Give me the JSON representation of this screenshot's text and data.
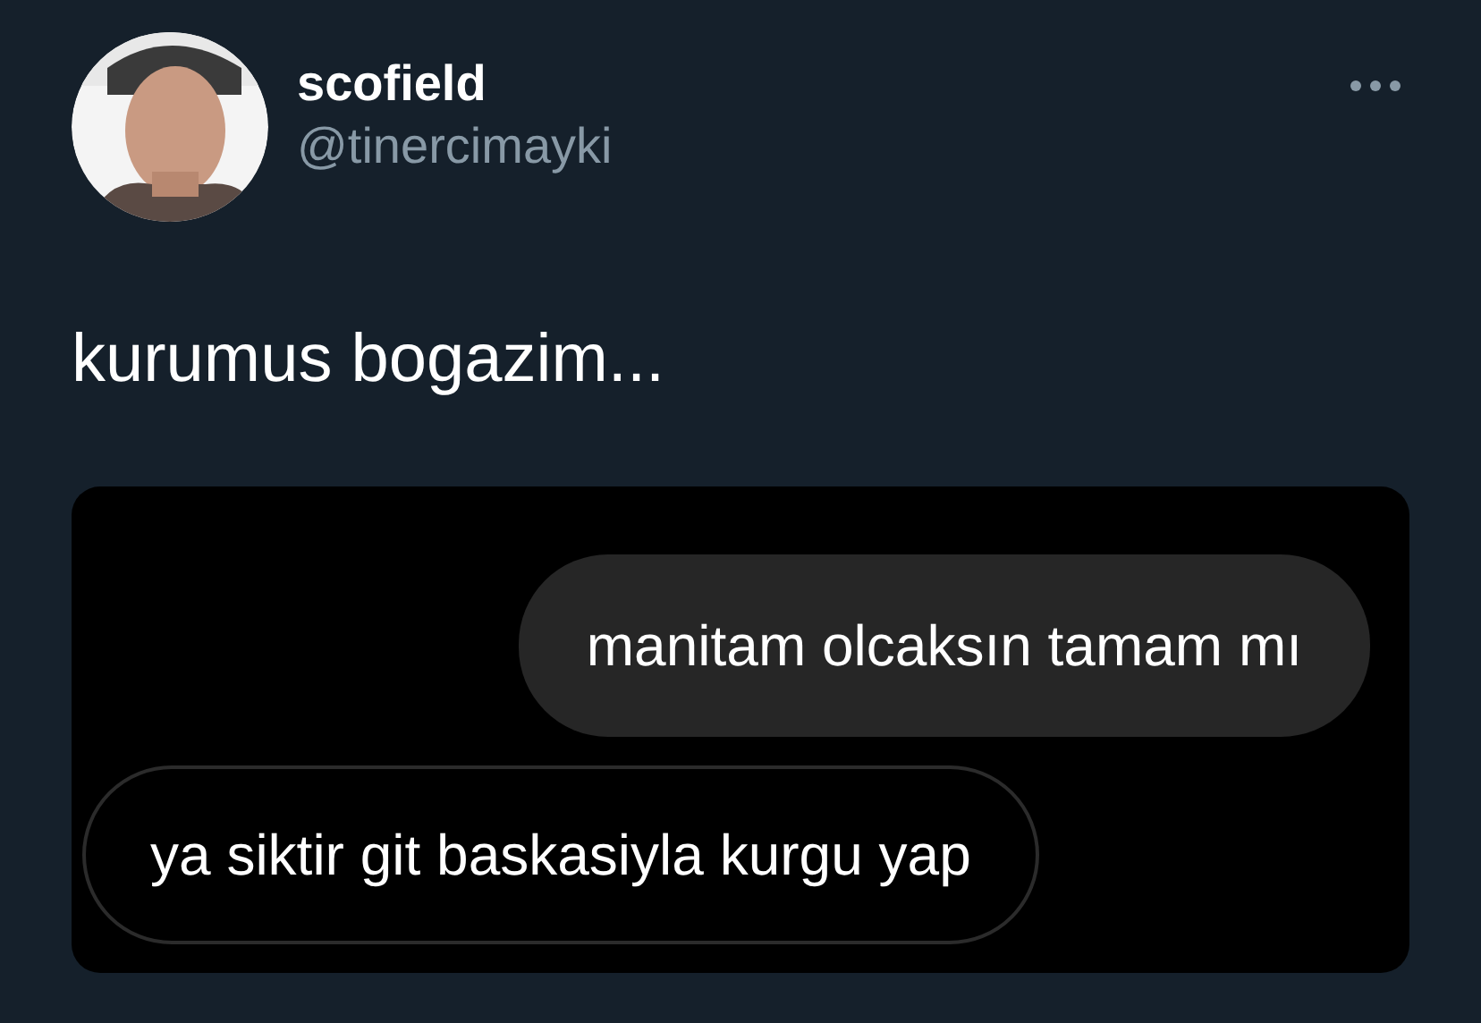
{
  "author": {
    "name": "scofield",
    "handle": "@tinercimayki"
  },
  "tweet": {
    "text": "kurumus bogazim..."
  },
  "media": {
    "messages": [
      {
        "kind": "sent",
        "text": "manitam olcaksın tamam mı"
      },
      {
        "kind": "received",
        "text": "ya siktir git baskasiyla kurgu yap"
      }
    ]
  }
}
